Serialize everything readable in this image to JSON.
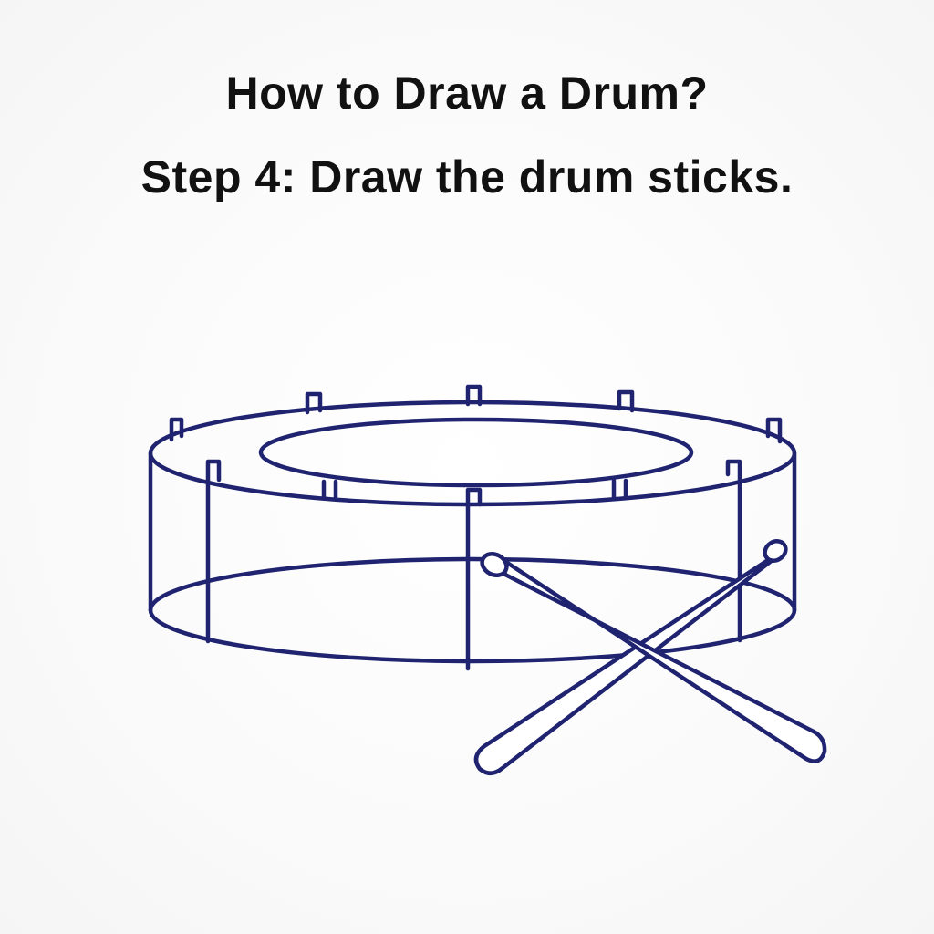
{
  "header": {
    "title": "How to Draw a Drum?",
    "step": "Step 4: Draw the drum sticks."
  },
  "colors": {
    "line": "#1f2370",
    "background": "#fbfbfb",
    "text": "#111111"
  }
}
